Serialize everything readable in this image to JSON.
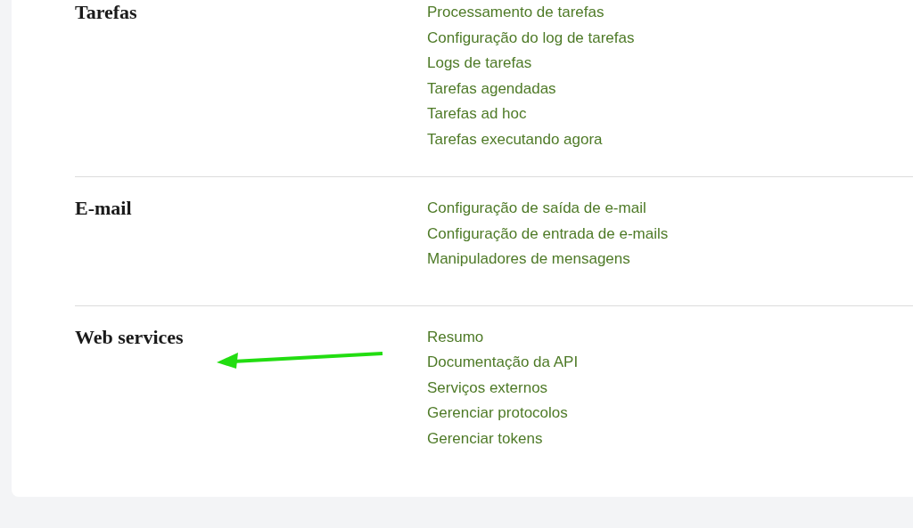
{
  "sections": [
    {
      "title": "Tarefas",
      "links": [
        "Processamento de tarefas",
        "Configuração do log de tarefas",
        "Logs de tarefas",
        "Tarefas agendadas",
        "Tarefas ad hoc",
        "Tarefas executando agora"
      ]
    },
    {
      "title": "E-mail",
      "links": [
        "Configuração de saída de e-mail",
        "Configuração de entrada de e-mails",
        "Manipuladores de mensagens"
      ]
    },
    {
      "title": "Web services",
      "links": [
        "Resumo",
        "Documentação da API",
        "Serviços externos",
        "Gerenciar protocolos",
        "Gerenciar tokens"
      ]
    }
  ]
}
